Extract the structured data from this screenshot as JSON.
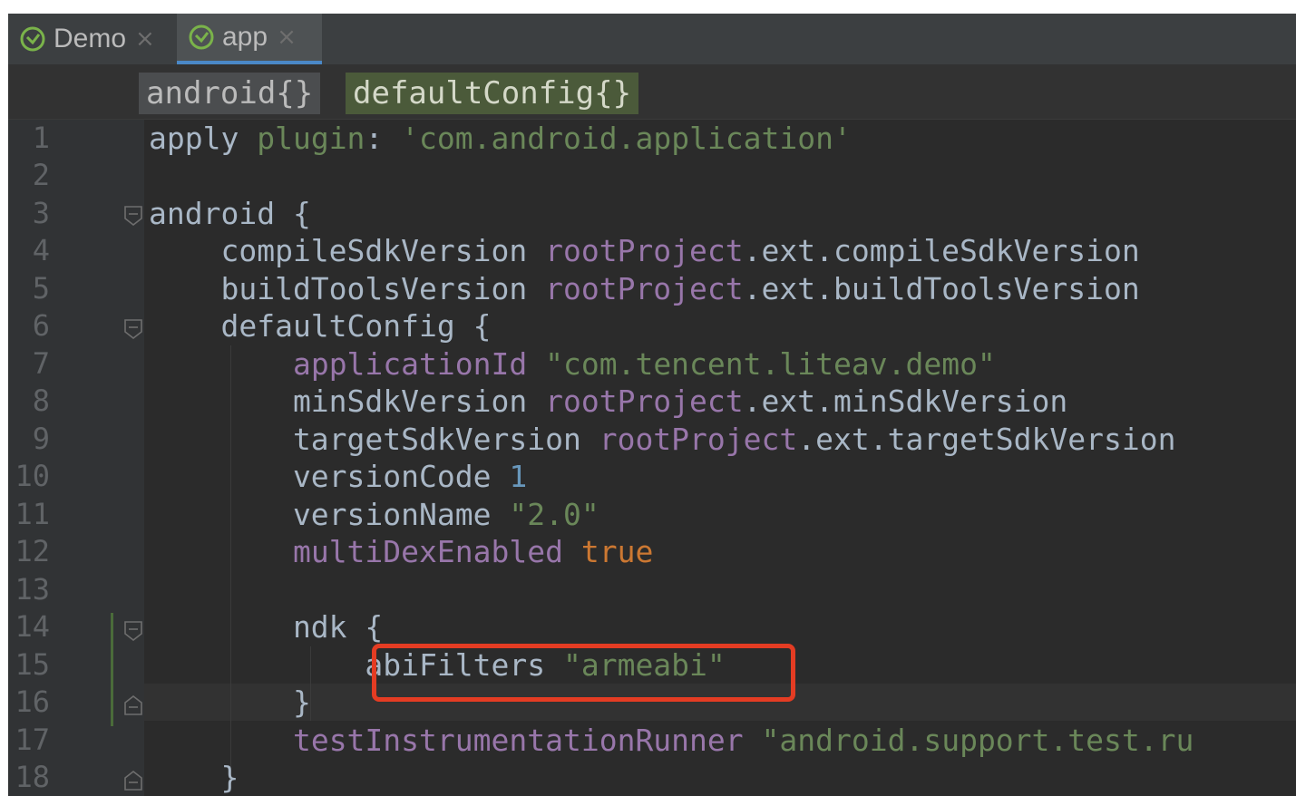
{
  "tabs": [
    {
      "label": "Demo",
      "icon": "gradle-icon",
      "active": false
    },
    {
      "label": "app",
      "icon": "gradle-icon",
      "active": true
    }
  ],
  "close_glyph": "×",
  "breadcrumbs": [
    "android{}",
    "defaultConfig{}"
  ],
  "line_numbers": [
    "1",
    "2",
    "3",
    "4",
    "5",
    "6",
    "7",
    "8",
    "9",
    "10",
    "11",
    "12",
    "13",
    "14",
    "15",
    "16",
    "17",
    "18"
  ],
  "code": {
    "l1": {
      "a": "apply ",
      "b": "plugin",
      "c": ": ",
      "d": "'com.android.application'"
    },
    "l3": {
      "a": "android {"
    },
    "l4": {
      "a": "    compileSdkVersion ",
      "b": "rootProject",
      "c": ".ext.compileSdkVersion"
    },
    "l5": {
      "a": "    buildToolsVersion ",
      "b": "rootProject",
      "c": ".ext.buildToolsVersion"
    },
    "l6": {
      "a": "    defaultConfig {"
    },
    "l7": {
      "a": "        ",
      "b": "applicationId",
      "c": " ",
      "d": "\"com.tencent.liteav.demo\""
    },
    "l8": {
      "a": "        minSdkVersion ",
      "b": "rootProject",
      "c": ".ext.minSdkVersion"
    },
    "l9": {
      "a": "        targetSdkVersion ",
      "b": "rootProject",
      "c": ".ext.targetSdkVersion"
    },
    "l10": {
      "a": "        versionCode ",
      "b": "1"
    },
    "l11": {
      "a": "        versionName ",
      "b": "\"2.0\""
    },
    "l12": {
      "a": "        ",
      "b": "multiDexEnabled",
      "c": " ",
      "d": "true"
    },
    "l14": {
      "a": "        ndk {"
    },
    "l15": {
      "a": "            abiFilters ",
      "b": "\"armeabi\""
    },
    "l16": {
      "a": "        }"
    },
    "l17": {
      "a": "        ",
      "b": "testInstrumentationRunner",
      "c": " ",
      "d": "\"android.support.test.ru"
    },
    "l18": {
      "a": "    }"
    }
  },
  "colors": {
    "background": "#2b2b2b",
    "gutter": "#313335",
    "annotation_box": "#e43c23",
    "string": "#6a8759",
    "property": "#9876aa",
    "number": "#6897bb",
    "keyword": "#cc7832"
  }
}
